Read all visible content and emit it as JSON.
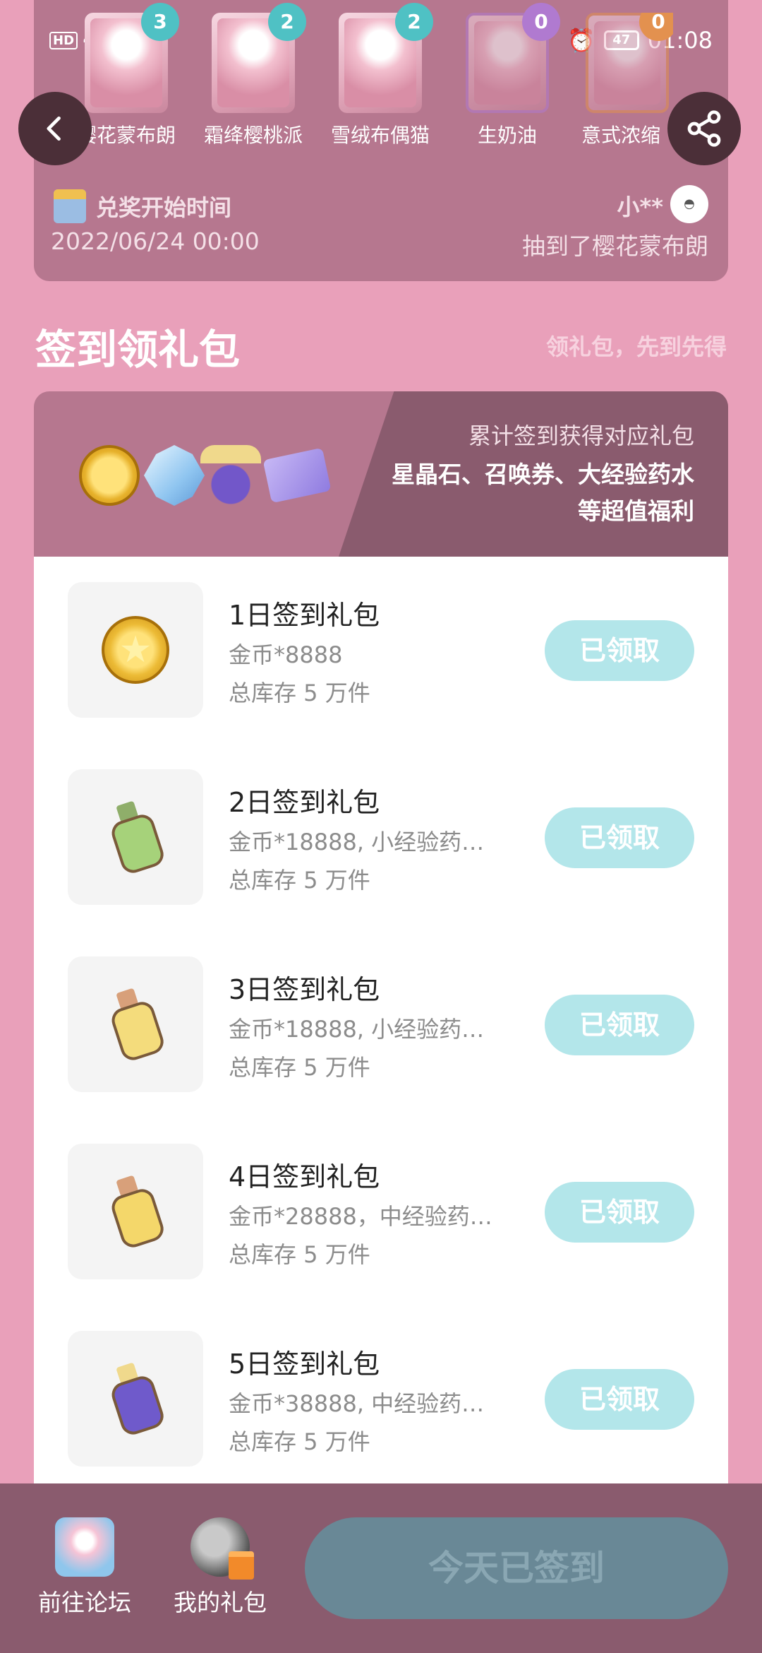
{
  "status_bar": {
    "hd": "HD",
    "signal": "4G",
    "battery": "47",
    "time": "01:08"
  },
  "prizes": [
    {
      "name": "樱花蒙布朗",
      "count": "3",
      "badge_color": "#4fc1c4"
    },
    {
      "name": "霜绛樱桃派",
      "count": "2",
      "badge_color": "#4fc1c4"
    },
    {
      "name": "雪绒布偶猫",
      "count": "2",
      "badge_color": "#4fc1c4"
    },
    {
      "name": "生奶油",
      "count": "0",
      "badge_color": "#b07ad0"
    },
    {
      "name": "意式浓缩",
      "count": "0",
      "badge_color": "#e3914f"
    }
  ],
  "redeem": {
    "label": "兑奖开始时间",
    "date": "2022/06/24 00:00"
  },
  "winner": {
    "name": "小**",
    "text": "抽到了樱花蒙布朗"
  },
  "section": {
    "title": "签到领礼包",
    "subtitle": "领礼包，先到先得"
  },
  "banner": {
    "line1": "累计签到获得对应礼包",
    "line2": "星晶石、召唤券、大经验药水等超值福利"
  },
  "rewards": [
    {
      "title": "1日签到礼包",
      "desc": "金币*8888",
      "stock": "总库存 5 万件",
      "button": "已领取",
      "icon": "gold-coin-icon"
    },
    {
      "title": "2日签到礼包",
      "desc": "金币*18888, 小经验药…",
      "stock": "总库存 5 万件",
      "button": "已领取",
      "icon": "green-potion-icon"
    },
    {
      "title": "3日签到礼包",
      "desc": "金币*18888, 小经验药…",
      "stock": "总库存 5 万件",
      "button": "已领取",
      "icon": "yellow-potion-icon"
    },
    {
      "title": "4日签到礼包",
      "desc": "金币*28888，中经验药…",
      "stock": "总库存 5 万件",
      "button": "已领取",
      "icon": "yellow-potion-icon"
    },
    {
      "title": "5日签到礼包",
      "desc": "金币*38888, 中经验药…",
      "stock": "总库存 5 万件",
      "button": "已领取",
      "icon": "purple-potion-icon"
    }
  ],
  "bottom": {
    "forum": "前往论坛",
    "gifts": "我的礼包",
    "signed": "今天已签到"
  },
  "colors": {
    "page_bg": "#e9a0ba",
    "panel": "#b6778f",
    "dark_panel": "#8a5b6e",
    "claim_button": "#b3e6ea",
    "signed_button": "#698896"
  }
}
